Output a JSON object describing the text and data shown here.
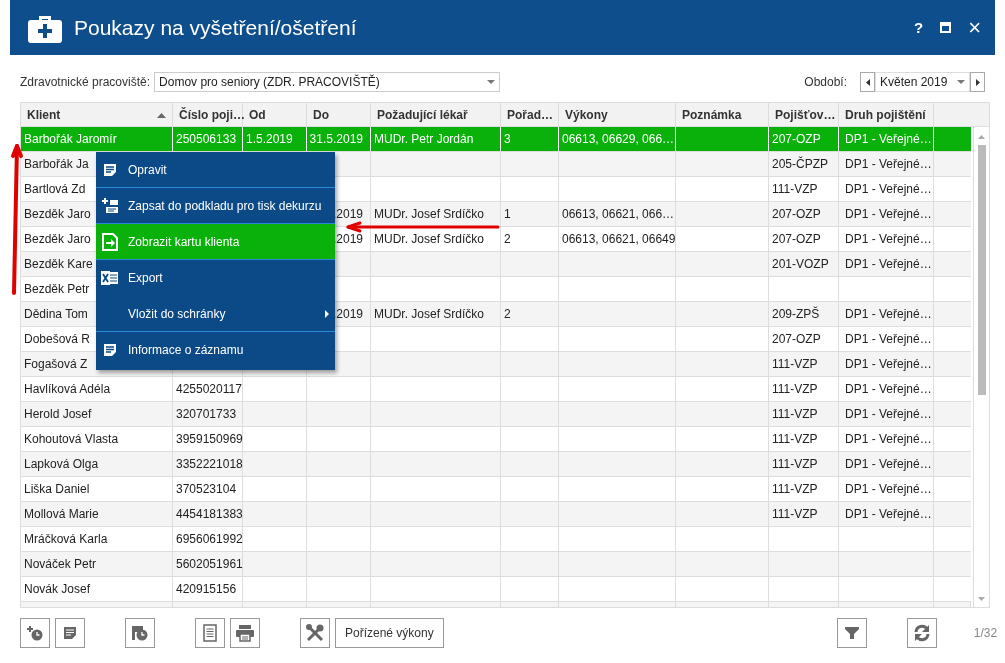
{
  "window": {
    "title": "Poukazy na vyšetření/ošetření",
    "help": "?",
    "close": "×"
  },
  "filters": {
    "workplace": {
      "label": "Zdravotnické pracoviště:",
      "value": "Domov pro seniory (ZDR. PRACOVIŠTĚ)"
    },
    "period": {
      "label": "Období:",
      "value": "Květen 2019"
    }
  },
  "table": {
    "columns": [
      {
        "label": "Klient",
        "sorted": true
      },
      {
        "label": "Číslo poji…",
        "sorted": false
      },
      {
        "label": "Od",
        "sorted": false
      },
      {
        "label": "Do",
        "sorted": false
      },
      {
        "label": "Požadující lékař",
        "sorted": false
      },
      {
        "label": "Pořad…",
        "sorted": false
      },
      {
        "label": "Výkony",
        "sorted": false
      },
      {
        "label": "Poznámka",
        "sorted": false
      },
      {
        "label": "Pojišťov…",
        "sorted": false
      },
      {
        "label": "Druh pojištění",
        "sorted": false
      }
    ],
    "rows": [
      {
        "selected": true,
        "cells": [
          "Barbořák Jaromír",
          "250506133",
          "1.5.2019",
          "31.5.2019",
          "MUDr. Petr Jordán",
          "3",
          "06613, 06629, 066…",
          null,
          "207-OZP",
          "DP1 - Veřejné…"
        ]
      },
      {
        "selected": false,
        "cells": [
          "Barbořák Ja",
          null,
          null,
          null,
          null,
          null,
          null,
          null,
          "205-ČPZP",
          "DP1 - Veřejné…"
        ]
      },
      {
        "selected": false,
        "cells": [
          "Bartlová Zd",
          null,
          null,
          null,
          null,
          null,
          null,
          null,
          "111-VZP",
          "DP1 - Veřejné…"
        ]
      },
      {
        "selected": false,
        "cells": [
          "Bezděk Jaro",
          null,
          null,
          ".2019",
          "MUDr. Josef Srdíčko",
          "1",
          "06613, 06621, 066…",
          null,
          "207-OZP",
          "DP1 - Veřejné…"
        ]
      },
      {
        "selected": false,
        "cells": [
          "Bezděk Jaro",
          null,
          null,
          ".2019",
          "MUDr. Josef Srdíčko",
          "2",
          "06613, 06621, 06649",
          null,
          "207-OZP",
          "DP1 - Veřejné…"
        ]
      },
      {
        "selected": false,
        "cells": [
          "Bezděk Kare",
          null,
          null,
          null,
          null,
          null,
          null,
          null,
          "201-VOZP",
          "DP1 - Veřejné…"
        ]
      },
      {
        "selected": false,
        "cells": [
          "Bezděk Petr",
          null,
          null,
          null,
          null,
          null,
          null,
          null,
          null,
          null
        ]
      },
      {
        "selected": false,
        "cells": [
          "Dědina Tom",
          null,
          null,
          ".2019",
          "MUDr. Josef Srdíčko",
          "2",
          null,
          null,
          "209-ZPŠ",
          "DP1 - Veřejné…"
        ]
      },
      {
        "selected": false,
        "cells": [
          "Dobešová R",
          null,
          null,
          null,
          null,
          null,
          null,
          null,
          "207-OZP",
          "DP1 - Veřejné…"
        ]
      },
      {
        "selected": false,
        "cells": [
          "Fogašová Z",
          null,
          null,
          null,
          null,
          null,
          null,
          null,
          "111-VZP",
          "DP1 - Veřejné…"
        ]
      },
      {
        "selected": false,
        "cells": [
          "Havlíková Adéla",
          "4255020117",
          null,
          null,
          null,
          null,
          null,
          null,
          "111-VZP",
          "DP1 - Veřejné…"
        ]
      },
      {
        "selected": false,
        "cells": [
          "Herold Josef",
          "320701733",
          null,
          null,
          null,
          null,
          null,
          null,
          "111-VZP",
          "DP1 - Veřejné…"
        ]
      },
      {
        "selected": false,
        "cells": [
          "Kohoutová Vlasta",
          "3959150969",
          null,
          null,
          null,
          null,
          null,
          null,
          "111-VZP",
          "DP1 - Veřejné…"
        ]
      },
      {
        "selected": false,
        "cells": [
          "Lapková Olga",
          "3352221018",
          null,
          null,
          null,
          null,
          null,
          null,
          "111-VZP",
          "DP1 - Veřejné…"
        ]
      },
      {
        "selected": false,
        "cells": [
          "Liška Daniel",
          "370523104",
          null,
          null,
          null,
          null,
          null,
          null,
          "111-VZP",
          "DP1 - Veřejné…"
        ]
      },
      {
        "selected": false,
        "cells": [
          "Mollová Marie",
          "4454181383",
          null,
          null,
          null,
          null,
          null,
          null,
          "111-VZP",
          "DP1 - Veřejné…"
        ]
      },
      {
        "selected": false,
        "cells": [
          "Mráčková Karla",
          "6956061992",
          null,
          null,
          null,
          null,
          null,
          null,
          null,
          null
        ]
      },
      {
        "selected": false,
        "cells": [
          "Nováček Petr",
          "5602051961",
          null,
          null,
          null,
          null,
          null,
          null,
          null,
          null
        ]
      },
      {
        "selected": false,
        "cells": [
          "Novák Josef",
          "420915156",
          null,
          null,
          null,
          null,
          null,
          null,
          null,
          null
        ]
      }
    ]
  },
  "context_menu": {
    "items": [
      {
        "label": "Opravit",
        "selected": false,
        "submenu": false
      },
      {
        "label": "Zapsat do podkladu pro tisk dekurzu",
        "selected": false,
        "submenu": false
      },
      {
        "label": "Zobrazit kartu klienta",
        "selected": true,
        "submenu": false
      },
      {
        "label": "Export",
        "selected": false,
        "submenu": false
      },
      {
        "label": "Vložit do schránky",
        "selected": false,
        "submenu": true
      },
      {
        "label": "Informace o záznamu",
        "selected": false,
        "submenu": false
      }
    ]
  },
  "toolbar": {
    "text_button": "Pořízené výkony",
    "page": "1/32"
  }
}
